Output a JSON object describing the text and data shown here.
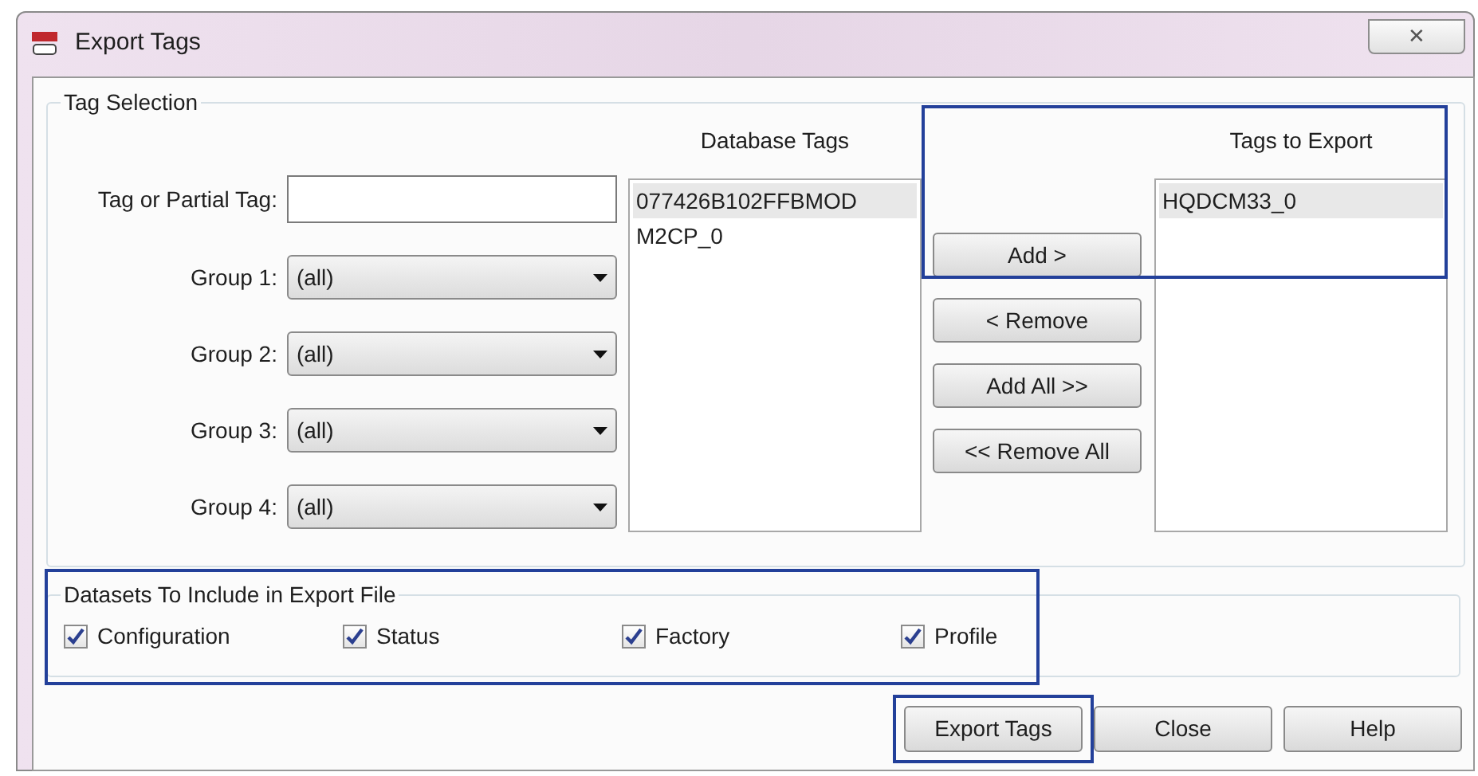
{
  "window": {
    "title": "Export Tags",
    "close_label": "✕"
  },
  "tag_selection": {
    "title": "Tag Selection",
    "search_label": "Tag or Partial Tag:",
    "groups": [
      {
        "label": "Group 1:",
        "value": "(all)"
      },
      {
        "label": "Group 2:",
        "value": "(all)"
      },
      {
        "label": "Group 3:",
        "value": "(all)"
      },
      {
        "label": "Group 4:",
        "value": "(all)"
      }
    ],
    "database_tags": {
      "title": "Database Tags",
      "items": [
        {
          "label": "077426B102FFBMOD",
          "selected": true
        },
        {
          "label": "M2CP_0",
          "selected": false
        }
      ]
    },
    "move_buttons": [
      "Add >",
      "< Remove",
      "Add All >>",
      "<< Remove All"
    ],
    "tags_to_export": {
      "title": "Tags to Export",
      "highlighted": true,
      "items": [
        {
          "label": "HQDCM33_0",
          "selected": true
        }
      ]
    }
  },
  "datasets": {
    "title": "Datasets To Include in Export File",
    "highlighted": true,
    "options": [
      {
        "label": "Configuration",
        "checked": true
      },
      {
        "label": "Status",
        "checked": true
      },
      {
        "label": "Factory",
        "checked": true
      },
      {
        "label": "Profile",
        "checked": true
      }
    ]
  },
  "buttons": [
    {
      "label": "Export Tags",
      "highlighted": true
    },
    {
      "label": "Close",
      "highlighted": false
    },
    {
      "label": "Help",
      "highlighted": false
    }
  ]
}
